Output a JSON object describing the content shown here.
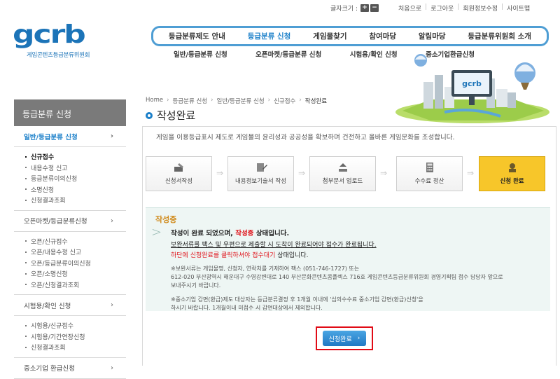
{
  "util": {
    "font_size_label": "글자크기 :",
    "font_plus": "+",
    "font_minus": "−",
    "links": [
      "처음으로",
      "로그아웃",
      "회원정보수정",
      "사이트맵"
    ]
  },
  "logo": {
    "mark": "gcrb",
    "subtitle": "게임콘텐츠등급분류위원회"
  },
  "main_nav": [
    "등급분류제도 안내",
    "등급분류 신청",
    "게임물찾기",
    "참여마당",
    "알림마당",
    "등급분류위원회 소개"
  ],
  "main_nav_active_index": 1,
  "sub_nav": [
    "일반/등급분류 신청",
    "오픈마켓/등급분류 신청",
    "시험용/확인 신청",
    "중소기업환급신청"
  ],
  "sidebar": {
    "header": "등급분류 신청",
    "sections": [
      {
        "label": "일반/등급분류 신청",
        "chevron": "›",
        "active": true,
        "items": [
          "신규접수",
          "내용수정 신고",
          "등급분류이의신청",
          "소명신청",
          "신청결과조회"
        ],
        "current": 0
      },
      {
        "label": "오픈마켓/등급분류신청",
        "chevron": "›",
        "items": [
          "오픈/신규접수",
          "오픈/내용수정 신고",
          "오픈/등급분류이의신청",
          "오픈/소명신청",
          "오픈/신청결과조회"
        ]
      },
      {
        "label": "시험용/확인 신청",
        "chevron": "›",
        "items": [
          "시험용/신규접수",
          "시험용/기간연장신청",
          "신청결과조회"
        ]
      },
      {
        "label": "중소기업 환급신청",
        "chevron": "›"
      }
    ]
  },
  "breadcrumb": [
    "Home",
    "등급분류 신청",
    "일반/등급분류 신청",
    "신규접수",
    "작성완료"
  ],
  "breadcrumb_sep": "›",
  "page_title": "작성완료",
  "intro": "게임을 이용등급표시 제도로 게임물의 윤리성과 공공성을 확보하며 건전하고 올바른 게임문화를 조성합니다.",
  "steps": [
    {
      "label": "신청서작성",
      "icon": "hand-pen-icon"
    },
    {
      "label": "내용정보기술서 작성",
      "icon": "document-pen-icon"
    },
    {
      "label": "첨부문서 업로드",
      "icon": "upload-icon"
    },
    {
      "label": "수수료 정산",
      "icon": "calculator-icon"
    },
    {
      "label": "신청 완료",
      "icon": "complete-icon"
    }
  ],
  "step_arrow": "⇒",
  "message": {
    "title": "작성중",
    "line1_pre": "작성이 완료 되었으며, ",
    "line1_red": "작성중",
    "line1_post": " 상태입니다.",
    "line2": "보완서류를 팩스 및 우편으로 제출할 시 도착이 완료되어야 접수가 완료됩니다.",
    "line3_red": "하단에 신청완료를 클릭하셔야 접수대기",
    "line3_post": " 상태입니다.",
    "note1": [
      "※보완서류는 게임물명, 신청자, 연락처를 기재하여 팩스 (051-746-1727) 또는",
      "612-020 부산광역시 해운대구 수영강변대로 140 부산문화콘텐츠콤플렉스 716호 게임콘텐츠등급분류위원회 경영기획팀 접수 담당자 앞으로",
      "보내주시기 바랍니다."
    ],
    "note2": [
      "※중소기업 감면(환급)제도 대상자는 등급분류결정 후 1개월 이내에 '심의수수료 중소기업 감면(환급)신청'을",
      "하시기 바랍니다. 1개월이내 미접수 시 감면대상에서 제외합니다."
    ]
  },
  "complete_button": {
    "label": "신청완료",
    "arrow": "›"
  },
  "colors": {
    "accent": "#1a7fc9",
    "highlight": "#f7c62a",
    "alert": "#e0141b"
  }
}
